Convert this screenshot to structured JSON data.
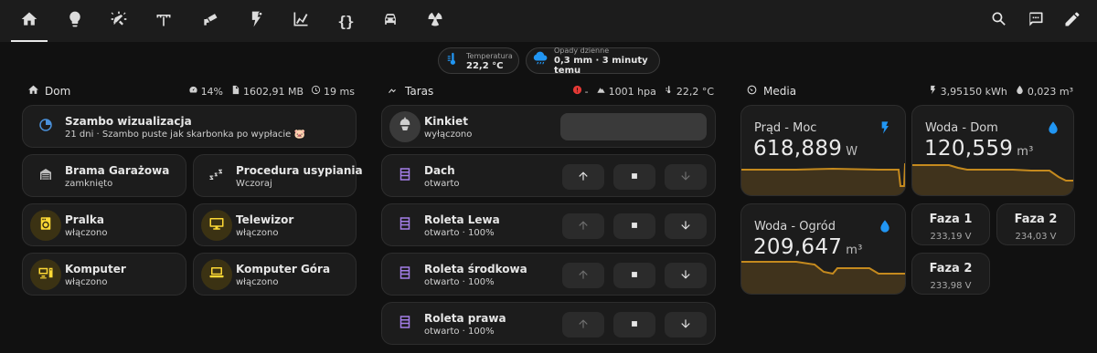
{
  "topbar": {
    "tabs": [
      {
        "icon": "home-icon"
      },
      {
        "icon": "lightbulb-icon"
      },
      {
        "icon": "sprinkler-icon"
      },
      {
        "icon": "antenna-icon"
      },
      {
        "icon": "cctv-icon"
      },
      {
        "icon": "flash-eye-icon"
      },
      {
        "icon": "chart-icon"
      },
      {
        "icon": "code-braces-icon",
        "text": "{}"
      },
      {
        "icon": "car-icon"
      },
      {
        "icon": "radioactive-icon"
      }
    ],
    "actions": [
      "search-icon",
      "assist-icon",
      "edit-icon"
    ]
  },
  "badges": [
    {
      "label": "Temperatura",
      "value": "22,2 °C",
      "icon": "thermometer-icon"
    },
    {
      "label": "Opady dzienne",
      "value": "0,3 mm · 3 minuty temu",
      "icon": "rain-cloud-icon"
    }
  ],
  "sections": {
    "dom": {
      "title": "Dom",
      "cpu": "14%",
      "memory": "1602,91 MB",
      "uptime": "19 ms"
    },
    "taras": {
      "title": "Taras",
      "alert": "-",
      "pressure": "1001 hpa",
      "temperature": "22,2 °C"
    },
    "media": {
      "title": "Media",
      "energy": "3,95150 kWh",
      "water": "0,023 m³"
    }
  },
  "dom_tiles": [
    {
      "name": "Szambo wizualizacja",
      "state": "21 dni · Szambo puste jak skarbonka po wypłacie 🐷"
    },
    {
      "name": "Brama Garażowa",
      "state": "zamknięto"
    },
    {
      "name": "Procedura usypiania",
      "state": "Wczoraj"
    },
    {
      "name": "Pralka",
      "state": "włączono"
    },
    {
      "name": "Telewizor",
      "state": "włączono"
    },
    {
      "name": "Komputer",
      "state": "włączono"
    },
    {
      "name": "Komputer Góra",
      "state": "włączono"
    }
  ],
  "taras_tiles": [
    {
      "name": "Kinkiet",
      "state": "wyłączono"
    },
    {
      "name": "Dach",
      "state": "otwarto"
    },
    {
      "name": "Roleta Lewa",
      "state": "otwarto · 100%"
    },
    {
      "name": "Roleta środkowa",
      "state": "otwarto · 100%"
    },
    {
      "name": "Roleta prawa",
      "state": "otwarto · 100%"
    }
  ],
  "media_cards": [
    {
      "name": "Prąd - Moc",
      "value": "618,889",
      "unit": "W",
      "icon": "flash-icon"
    },
    {
      "name": "Woda - Dom",
      "value": "120,559",
      "unit": "m³",
      "icon": "water-drop-icon"
    },
    {
      "name": "Woda - Ogród",
      "value": "209,647",
      "unit": "m³",
      "icon": "water-drop-icon"
    }
  ],
  "phases": [
    {
      "name": "Faza 1",
      "value": "233,19 V"
    },
    {
      "name": "Faza 2",
      "value": "234,03 V"
    },
    {
      "name": "Faza 2",
      "value": "233,98 V"
    }
  ],
  "colors": {
    "accent_blue": "#2196f3",
    "accent_yellow": "#fdd835",
    "accent_purple": "#a47ee8",
    "graph_orange": "#c58a1e",
    "alert_red": "#e53935"
  }
}
